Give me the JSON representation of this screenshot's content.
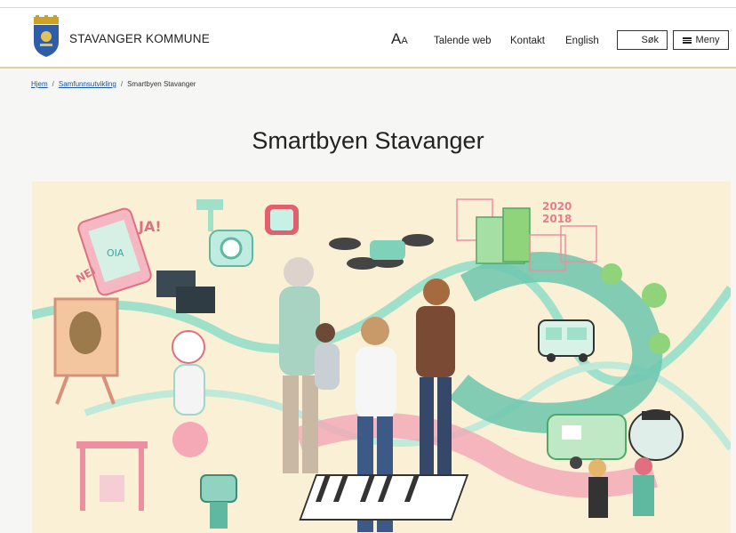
{
  "header": {
    "brand": "STAVANGER KOMMUNE",
    "text_size_label": "A",
    "text_size_small": "A",
    "nav": [
      "Talende web",
      "Kontakt",
      "English"
    ],
    "search_label": "Søk",
    "menu_label": "Meny"
  },
  "breadcrumb": {
    "items": [
      "Hjem",
      "Samfunnsutvikling"
    ],
    "current": "Smartbyen Stavanger"
  },
  "page": {
    "title": "Smartbyen Stavanger"
  },
  "hero": {
    "year_top": "2020",
    "year_bottom": "2018",
    "speech_ja": "JA!",
    "speech_nei": "NEI",
    "phone_sign": "OIA",
    "chart_text": "||"
  },
  "colors": {
    "pink": "#ee8a9b",
    "mint": "#7fd1b9",
    "teal": "#4fb7a0",
    "cream": "#faf0d6",
    "green": "#8fd37a"
  }
}
